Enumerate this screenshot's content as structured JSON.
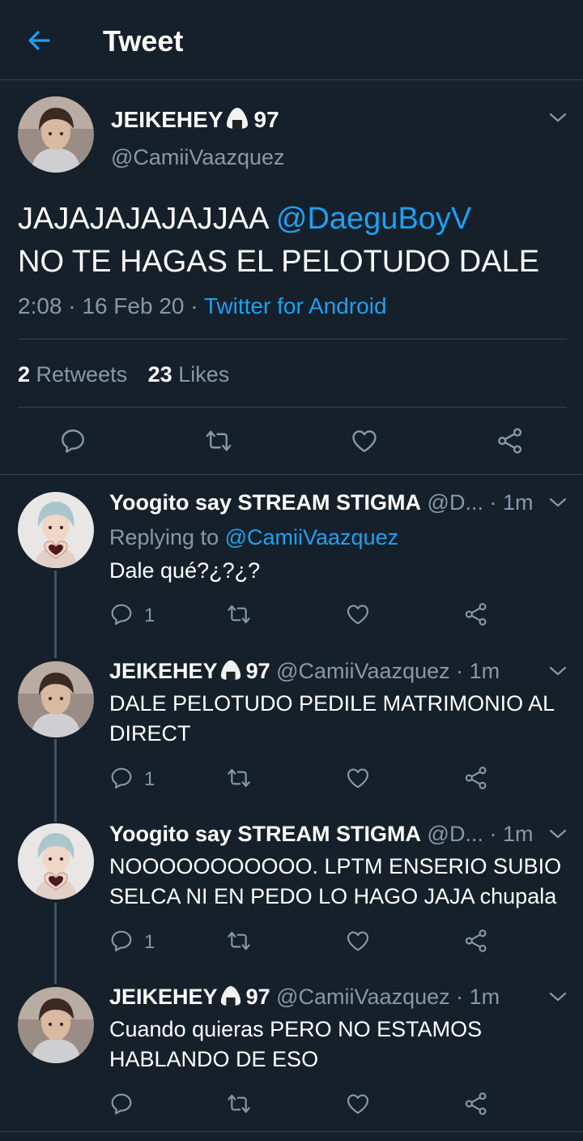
{
  "header": {
    "title": "Tweet",
    "back_icon": "arrow-left-icon"
  },
  "main_tweet": {
    "name": "JEIKEHEY",
    "name_emoji": "rice-ball-icon",
    "name_suffix": "97",
    "handle": "@CamiiVaazquez",
    "text_part1": "JAJAJAJAJAJJAA",
    "mention": "@DaeguBoyV",
    "text_part2": "NO TE HAGAS EL PELOTUDO DALE",
    "time": "2:08 · 16 Feb 20 ·",
    "source": "Twitter for Android",
    "retweet_count": "2",
    "retweet_label": "Retweets",
    "like_count": "23",
    "like_label": "Likes"
  },
  "replies": [
    {
      "name": "Yoogito say STREAM STIGMA",
      "handle": "@D...",
      "time": "· 1m",
      "replying_label": "Replying to",
      "replying_to": "@CamiiVaazquez",
      "text": "Dale qué?¿?¿?",
      "reply_count": "1"
    },
    {
      "name": "JEIKEHEY",
      "name_suffix": "97",
      "handle": "@CamiiVaazquez",
      "time": "· 1m",
      "text": "DALE PELOTUDO PEDILE MATRIMONIO AL DIRECT",
      "reply_count": "1"
    },
    {
      "name": "Yoogito say STREAM STIGMA",
      "handle": "@D...",
      "time": "· 1m",
      "text": "NOOOOOOOOOOO. LPTM ENSERIO SUBIO SELCA NI EN PEDO LO HAGO JAJA chupala",
      "reply_count": "1"
    },
    {
      "name": "JEIKEHEY",
      "name_suffix": "97",
      "handle": "@CamiiVaazquez",
      "time": "· 1m",
      "text": "Cuando quieras PERO NO ESTAMOS HABLANDO DE ESO",
      "reply_count": ""
    }
  ],
  "colors": {
    "background": "#15202b",
    "accent": "#1da1f2",
    "secondary_text": "#8899a6",
    "divider": "#38444d"
  }
}
